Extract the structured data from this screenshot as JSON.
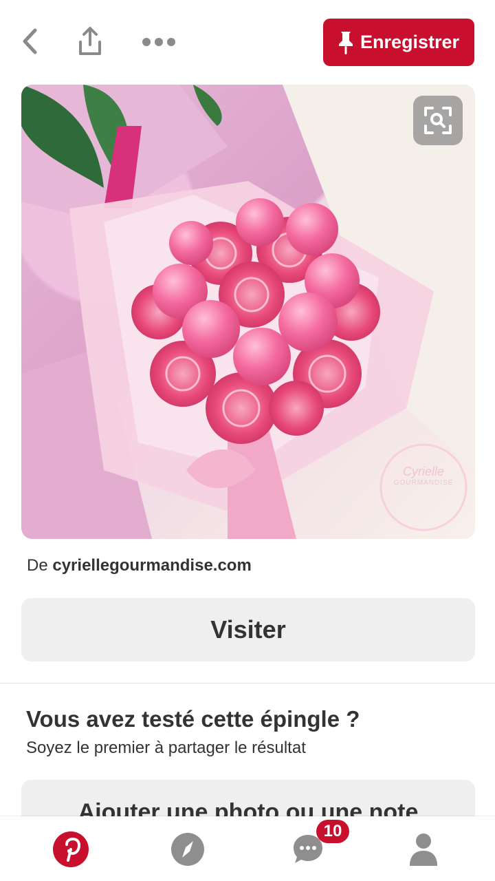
{
  "topbar": {
    "save_label": "Enregistrer"
  },
  "pin": {
    "image_alt": "Bouquet de bonbons roses",
    "watermark_line1": "Cyrielle",
    "watermark_line2": "GOURMANDISE"
  },
  "source": {
    "prefix": "De",
    "domain": "cyriellegourmandise.com"
  },
  "visit_label": "Visiter",
  "tried": {
    "title": "Vous avez testé cette épingle ?",
    "subtitle": "Soyez le premier à partager le résultat",
    "add_label": "Ajouter une photo ou une note"
  },
  "nav": {
    "messages_badge": "10"
  },
  "colors": {
    "brand": "#c8102e",
    "button_gray": "#efefef",
    "text": "#333333"
  },
  "icons": [
    "back-icon",
    "share-icon",
    "more-icon",
    "pin-icon",
    "visual-search-icon",
    "home-pinterest-icon",
    "explore-icon",
    "messages-icon",
    "profile-icon"
  ]
}
